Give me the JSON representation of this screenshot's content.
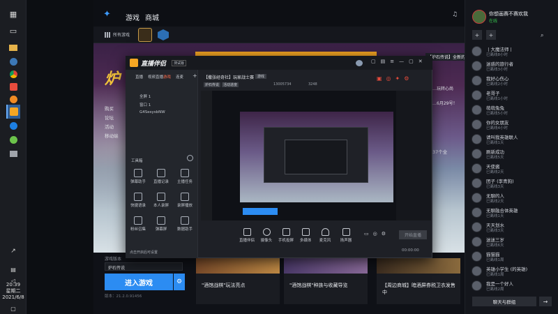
{
  "taskbar": {
    "clock_time": "20:39",
    "clock_day": "星期二",
    "clock_date": "2021/6/8"
  },
  "header": {
    "tab_games": "游戏",
    "tab_store": "商城",
    "all_games": "所有游戏"
  },
  "profile": {
    "name": "你想画赛不赛欢我",
    "status": "在线"
  },
  "hero": {
    "menu_items": [
      "购买",
      "论坛",
      "活动",
      "移动端"
    ],
    "banner_text": "【炉石传说】全新的卡组...",
    "side_line1": "…玩转心尚",
    "side_line2": "…6月29号！"
  },
  "streamer": {
    "app_title": "直播伴侣",
    "badge": "测试版",
    "tabs": [
      "直播",
      "视频直播",
      "游戏",
      "连麦"
    ],
    "scenes": [
      "全屏 1",
      "窗口 1",
      "G4SesysbNW"
    ],
    "tools_header": "工具箱",
    "tools": [
      "弹幕助手",
      "直播记录",
      "主播任务",
      "快捷语录",
      "本人录屏",
      "录屏播放",
      "粉丝召集",
      "弹幕屏",
      "数据助手"
    ],
    "stream_title": "【撒张经奇社】玩家战士赛",
    "stream_tag": "游戏",
    "stream_meta1": "炉石传说",
    "stream_meta2": "活动进度",
    "stream_id": "13005734",
    "stream_heat": "3248",
    "controls": [
      "直播伴侣",
      "摄像头",
      "手机投屏",
      "多媒体",
      "麦克风",
      "扬声器"
    ],
    "start_button": "开始直播",
    "timer": "00:00:00",
    "footer_note": "点击开启后可设置"
  },
  "left_panel": {
    "region_label": "游戏版本",
    "region_value": "炉石传说",
    "enter_button": "进入游戏",
    "version": "版本：21.2.0.91456"
  },
  "cards": [
    "\"酒馆战棋\"玩法亮点",
    "\"酒馆战棋\"种族与收藏导览",
    "【周边商城】暗酒屏券税卫衣发售中"
  ],
  "friends": {
    "list": [
      {
        "name": "丨大魔法师丨",
        "status": "已离线8小时"
      },
      {
        "name": "迷惑的旅行者",
        "status": "已离线3小时"
      },
      {
        "name": "我好心伤心",
        "status": "已离线2小时"
      },
      {
        "name": "老哥子",
        "status": "已离线1小时"
      },
      {
        "name": "萌萌兔兔",
        "status": "已离线5小时"
      },
      {
        "name": "你的女朋友",
        "status": "已离线4小时"
      },
      {
        "name": "请叫我英雄联人",
        "status": "已离线1天"
      },
      {
        "name": "刷新成功",
        "status": "已离线5天"
      },
      {
        "name": "天使酱",
        "status": "已离线2天"
      },
      {
        "name": "团子 (李青狗)",
        "status": "已离线3天"
      },
      {
        "name": "无聊的人",
        "status": "已离线2天"
      },
      {
        "name": "无聊融合体英雄",
        "status": "已离线1天"
      },
      {
        "name": "天天划水",
        "status": "已离线3天"
      },
      {
        "name": "迷迷三岁",
        "status": "已离线6天"
      },
      {
        "name": "猫猫猫",
        "status": "已离线1周"
      },
      {
        "name": "英雄小学生 (的英雄)",
        "status": "已离线1周"
      },
      {
        "name": "我是一个好人",
        "status": "已离线2周"
      }
    ],
    "bottom_button": "聊天与群组"
  }
}
